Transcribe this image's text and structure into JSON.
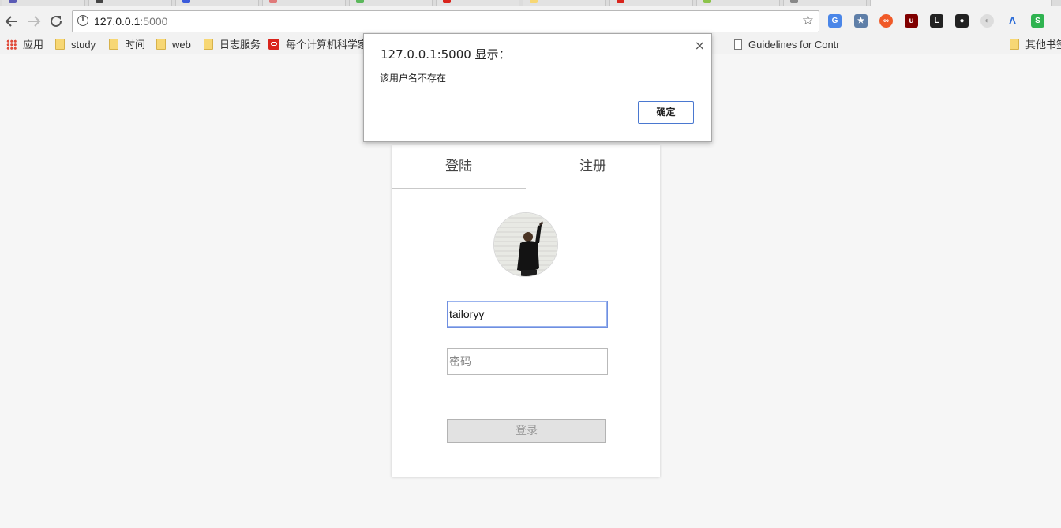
{
  "browser": {
    "url_host": "127.0.0.1",
    "url_port": ":5000",
    "bookmarks": [
      {
        "label": "应用",
        "icon": "apps-icon"
      },
      {
        "label": "study",
        "icon": "folder-icon"
      },
      {
        "label": "时间",
        "icon": "folder-icon"
      },
      {
        "label": "web",
        "icon": "folder-icon"
      },
      {
        "label": "日志服务",
        "icon": "folder-icon"
      },
      {
        "label": "每个计算机科学家",
        "icon": "oracle-icon"
      },
      {
        "label": "Guidelines for Contr",
        "icon": "document-icon"
      },
      {
        "label": "其他书签",
        "icon": "folder-icon"
      }
    ]
  },
  "dialog": {
    "title": "127.0.0.1:5000 显示：",
    "message": "该用户名不存在",
    "ok_label": "确定",
    "close_glyph": "×"
  },
  "card": {
    "tab_login": "登陆",
    "tab_register": "注册",
    "username_value": "tailoryy",
    "password_placeholder": "密码",
    "submit_label": "登录"
  },
  "colors": {
    "accent": "#4a78d0",
    "page_bg": "#f6f6f6"
  }
}
